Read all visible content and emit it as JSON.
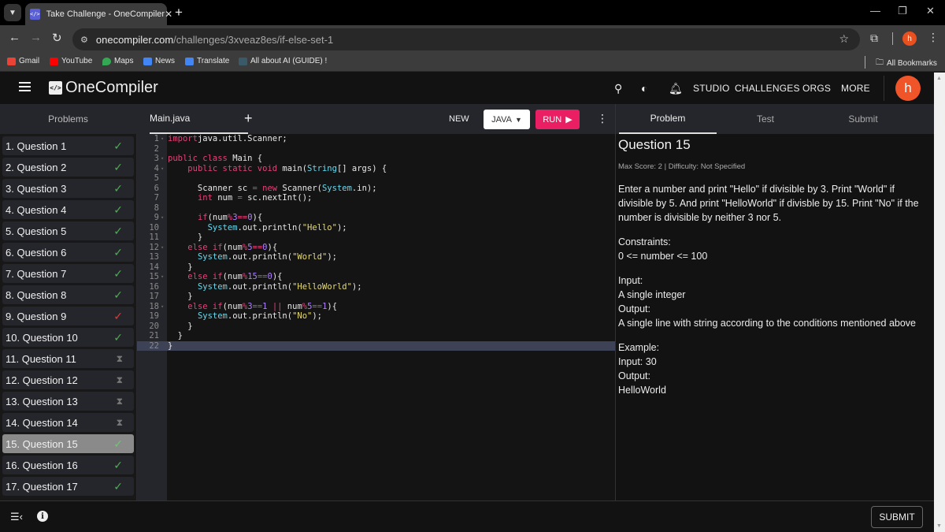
{
  "browser": {
    "tab_title": "Take Challenge - OneCompiler",
    "favicon_text": "</>",
    "url_host": "onecompiler.com",
    "url_path": "/challenges/3xveaz8es/if-else-set-1",
    "profile_initial": "h",
    "bookmarks": [
      {
        "label": "Gmail",
        "color": "#ea4335"
      },
      {
        "label": "YouTube",
        "color": "#ff0000"
      },
      {
        "label": "Maps",
        "color": "#34a853"
      },
      {
        "label": "News",
        "color": "#4285f4"
      },
      {
        "label": "Translate",
        "color": "#4285f4"
      },
      {
        "label": "All about AI (GUIDE) !",
        "color": "#3a5a6a"
      }
    ],
    "all_bookmarks": "All Bookmarks"
  },
  "header": {
    "logo_mark": "</>",
    "logo_text": "OneCompiler",
    "nav": [
      "STUDIO",
      "CHALLENGES",
      "ORGS",
      "MORE"
    ],
    "avatar_initial": "h"
  },
  "problems": {
    "title": "Problems",
    "items": [
      {
        "label": "1. Question 1",
        "status": "solved"
      },
      {
        "label": "2. Question 2",
        "status": "solved"
      },
      {
        "label": "3. Question 3",
        "status": "solved"
      },
      {
        "label": "4. Question 4",
        "status": "solved"
      },
      {
        "label": "5. Question 5",
        "status": "solved"
      },
      {
        "label": "6. Question 6",
        "status": "solved"
      },
      {
        "label": "7. Question 7",
        "status": "solved"
      },
      {
        "label": "8. Question 8",
        "status": "solved"
      },
      {
        "label": "9. Question 9",
        "status": "failed"
      },
      {
        "label": "10. Question 10",
        "status": "solved"
      },
      {
        "label": "11. Question 11",
        "status": "pending"
      },
      {
        "label": "12. Question 12",
        "status": "pending"
      },
      {
        "label": "13. Question 13",
        "status": "pending"
      },
      {
        "label": "14. Question 14",
        "status": "pending"
      },
      {
        "label": "15. Question 15",
        "status": "solved",
        "active": true
      },
      {
        "label": "16. Question 16",
        "status": "solved"
      },
      {
        "label": "17. Question 17",
        "status": "solved"
      }
    ]
  },
  "editor": {
    "file_name": "Main.java",
    "new_label": "NEW",
    "language": "JAVA",
    "run_label": "RUN",
    "current_line": 22,
    "lines": [
      [
        [
          "kw",
          "import"
        ],
        [
          "",
          "java.util.Scanner;"
        ]
      ],
      [],
      [
        [
          "kw",
          "public class "
        ],
        [
          "",
          "Main {"
        ]
      ],
      [
        [
          "",
          "    "
        ],
        [
          "kw",
          "public static void "
        ],
        [
          "",
          "main("
        ],
        [
          "ty",
          "String"
        ],
        [
          "",
          "[] args) {"
        ]
      ],
      [],
      [
        [
          "",
          "      Scanner sc "
        ],
        [
          "op",
          "="
        ],
        [
          "kw",
          " new "
        ],
        [
          "",
          "Scanner("
        ],
        [
          "ty",
          "System"
        ],
        [
          "",
          ".in);"
        ]
      ],
      [
        [
          "",
          "      "
        ],
        [
          "kw",
          "int"
        ],
        [
          "",
          " num "
        ],
        [
          "op",
          "="
        ],
        [
          "",
          " sc.nextInt();"
        ]
      ],
      [],
      [
        [
          "",
          "      "
        ],
        [
          "kw",
          "if"
        ],
        [
          "",
          "(num"
        ],
        [
          "op",
          "%"
        ],
        [
          "num",
          "3"
        ],
        [
          "op",
          "=="
        ],
        [
          "num",
          "0"
        ],
        [
          "",
          "){"
        ]
      ],
      [
        [
          "",
          "        "
        ],
        [
          "ty",
          "System"
        ],
        [
          "",
          ".out.println("
        ],
        [
          "str",
          "\"Hello\""
        ],
        [
          "",
          ");"
        ]
      ],
      [
        [
          "",
          "      }"
        ]
      ],
      [
        [
          "",
          "    "
        ],
        [
          "kw",
          "else if"
        ],
        [
          "",
          "(num"
        ],
        [
          "op",
          "%"
        ],
        [
          "num",
          "5"
        ],
        [
          "op",
          "=="
        ],
        [
          "num",
          "0"
        ],
        [
          "",
          "){"
        ]
      ],
      [
        [
          "",
          "      "
        ],
        [
          "ty",
          "System"
        ],
        [
          "",
          ".out.println("
        ],
        [
          "str",
          "\"World\""
        ],
        [
          "",
          ");"
        ]
      ],
      [
        [
          "",
          "    }"
        ]
      ],
      [
        [
          "",
          "    "
        ],
        [
          "kw",
          "else if"
        ],
        [
          "",
          "(num"
        ],
        [
          "op",
          "%"
        ],
        [
          "num",
          "15"
        ],
        [
          "op",
          "=="
        ],
        [
          "num",
          "0"
        ],
        [
          "",
          "){"
        ]
      ],
      [
        [
          "",
          "      "
        ],
        [
          "ty",
          "System"
        ],
        [
          "",
          ".out.println("
        ],
        [
          "str",
          "\"HelloWorld\""
        ],
        [
          "",
          ");"
        ]
      ],
      [
        [
          "",
          "    }"
        ]
      ],
      [
        [
          "",
          "    "
        ],
        [
          "kw",
          "else if"
        ],
        [
          "",
          "(num"
        ],
        [
          "op",
          "%"
        ],
        [
          "num",
          "3"
        ],
        [
          "op",
          "=="
        ],
        [
          "num",
          "1"
        ],
        [
          "op",
          " || "
        ],
        [
          "",
          "num"
        ],
        [
          "op",
          "%"
        ],
        [
          "num",
          "5"
        ],
        [
          "op",
          "=="
        ],
        [
          "num",
          "1"
        ],
        [
          "",
          "){"
        ]
      ],
      [
        [
          "",
          "      "
        ],
        [
          "ty",
          "System"
        ],
        [
          "",
          ".out.println("
        ],
        [
          "str",
          "\"No\""
        ],
        [
          "",
          ");"
        ]
      ],
      [
        [
          "",
          "    }"
        ]
      ],
      [
        [
          "",
          "  }"
        ]
      ],
      [
        [
          "",
          "}"
        ]
      ]
    ],
    "foldable": [
      1,
      3,
      4,
      9,
      12,
      15,
      18
    ]
  },
  "problem_panel": {
    "tabs": [
      "Problem",
      "Test",
      "Submit"
    ],
    "active_tab": "Problem",
    "title": "Question 15",
    "meta": "Max Score: 2 | Difficulty: Not Specified",
    "description": "Enter a number and print \"Hello\" if divisible by 3. Print \"World\" if divisible by 5. And print \"HelloWorld\" if divisble by 15. Print \"No\" if the number is divisible by neither 3 nor 5.",
    "constraints_label": "Constraints:",
    "constraints": "0 <= number <= 100",
    "input_label": "Input:",
    "input_desc": "A single integer",
    "output_label": "Output:",
    "output_desc": "A single line with string according to the conditions mentioned above",
    "example_label": "Example:",
    "example_input": "Input: 30",
    "example_output_label": "Output:",
    "example_output": "HelloWorld"
  },
  "footer": {
    "submit_label": "SUBMIT"
  }
}
